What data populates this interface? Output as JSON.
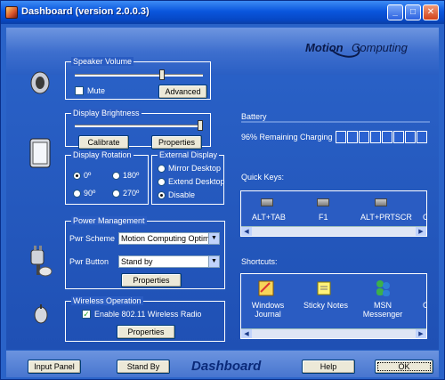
{
  "window": {
    "title": "Dashboard  (version 2.0.0.3)"
  },
  "logo": {
    "motion": "Motion",
    "computing": "Computing"
  },
  "speaker": {
    "group_title": "Speaker Volume",
    "mute_label": "Mute",
    "mute_checked": false,
    "advanced_label": "Advanced",
    "volume_level": 0.68
  },
  "brightness": {
    "group_title": "Display Brightness",
    "calibrate_label": "Calibrate",
    "properties_label": "Properties",
    "level": 0.98
  },
  "rotation": {
    "group_title": "Display Rotation",
    "options": [
      "0º",
      "180º",
      "90º",
      "270º"
    ],
    "selected": "0º"
  },
  "external": {
    "group_title": "External Display",
    "options": [
      "Mirror Desktop",
      "Extend Desktop",
      "Disable"
    ],
    "selected": "Disable"
  },
  "power": {
    "group_title": "Power Management",
    "scheme_label": "Pwr Scheme",
    "scheme_value": "Motion Computing Optimi",
    "button_label": "Pwr Button",
    "button_value": "Stand by",
    "properties_label": "Properties"
  },
  "wireless": {
    "group_title": "Wireless Operation",
    "enable_label": "Enable 802.11 Wireless Radio",
    "enabled": true,
    "properties_label": "Properties"
  },
  "battery": {
    "label": "Battery",
    "remaining": "96% Remaining",
    "status": "Charging"
  },
  "quick_keys": {
    "label": "Quick Keys:",
    "items": [
      "ALT+TAB",
      "F1",
      "ALT+PRTSCR",
      "C"
    ]
  },
  "shortcuts": {
    "label": "Shortcuts:",
    "items": [
      "Windows Journal",
      "Sticky Notes",
      "MSN Messenger",
      "C"
    ]
  },
  "bottom": {
    "input_panel": "Input Panel",
    "stand_by": "Stand By",
    "brand": "Dashboard",
    "help": "Help",
    "ok": "OK"
  }
}
